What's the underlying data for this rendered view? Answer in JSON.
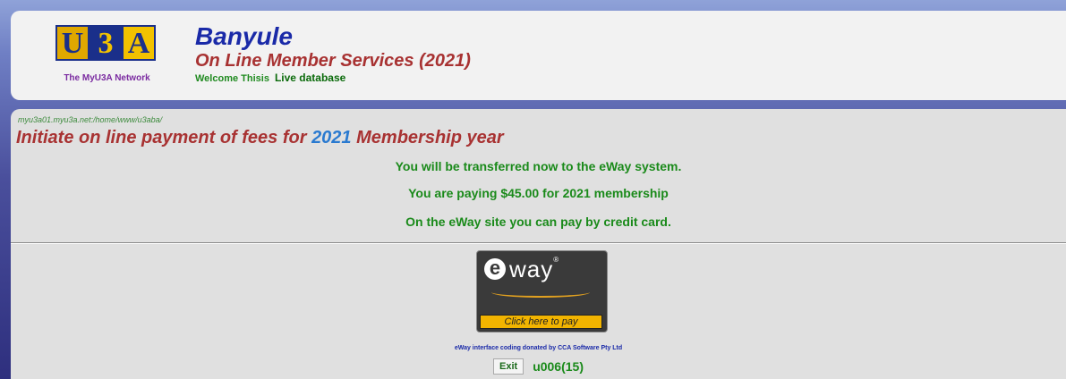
{
  "header": {
    "logo": {
      "letters": [
        "U",
        "3",
        "A"
      ],
      "network": "The MyU3A Network"
    },
    "org_name": "Banyule",
    "service_title": "On Line Member Services (2021)",
    "welcome": "Welcome Thisis",
    "db_status": "Live database"
  },
  "main": {
    "path": "myu3a01.myu3a.net:/home/www/u3aba/",
    "heading_prefix": "Initiate on line payment of fees for",
    "heading_year": "2021",
    "heading_suffix": "Membership year",
    "messages": [
      "You will be transferred now to the eWay system.",
      "You are paying $45.00 for 2021 membership",
      "On the eWay site you can pay by credit card."
    ],
    "eway_button": {
      "brand_e": "e",
      "brand_way": "way",
      "reg": "®",
      "label": "Click here to pay"
    },
    "donated": "eWay interface coding donated by CCA Software Pty Ltd",
    "exit_label": "Exit",
    "user_code": "u006(15)"
  },
  "colors": {
    "heading": "#a83232",
    "year": "#2a7ad0",
    "messages": "#1a8a1a",
    "brand_blue": "#1a2aa8"
  }
}
